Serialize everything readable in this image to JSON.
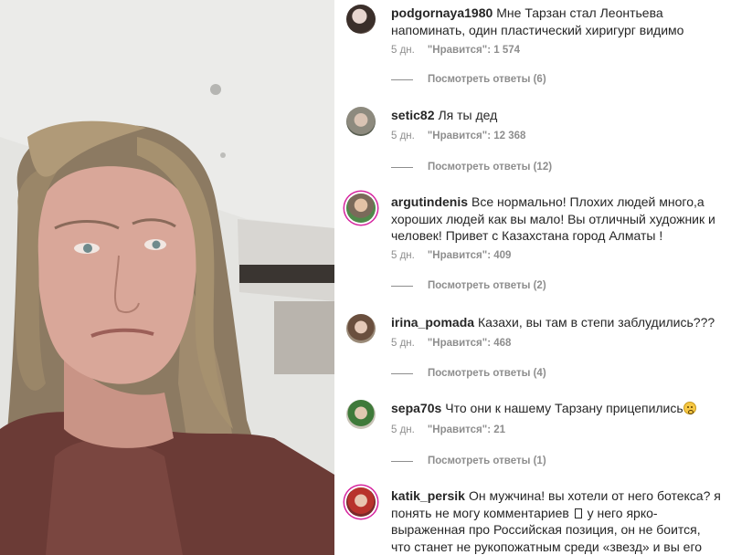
{
  "photo": {
    "description_icon": "portrait-photo"
  },
  "comments": [
    {
      "username": "podgornaya1980",
      "text": "Мне Тарзан стал Леонтьева напоминать, один пластический хиригург видимо",
      "time": "5 дн.",
      "likes": "\"Нравится\": 1 574",
      "replies": "Посмотреть ответы (6)"
    },
    {
      "username": "setic82",
      "text": "Ля ты дед",
      "time": "5 дн.",
      "likes": "\"Нравится\": 12 368",
      "replies": "Посмотреть ответы (12)"
    },
    {
      "username": "argutindenis",
      "text": "Все нормально! Плохих людей много,а хороших людей как вы мало! Вы отличный художник и человек! Привет с Казахстана город Алматы !",
      "time": "5 дн.",
      "likes": "\"Нравится\": 409",
      "replies": "Посмотреть ответы (2)"
    },
    {
      "username": "irina_pomada",
      "text": "Казахи, вы там в степи заблудились???",
      "time": "5 дн.",
      "likes": "\"Нравится\": 468",
      "replies": "Посмотреть ответы (4)"
    },
    {
      "username": "sepa70s",
      "text": "Что они к нашему Тарзану прицепились",
      "time": "5 дн.",
      "likes": "\"Нравится\": 21",
      "replies": "Посмотреть ответы (1)"
    },
    {
      "username": "katik_persik",
      "text_part1": "Он мужчина! вы хотели от него ботекса? я понять не могу комментариев",
      "text_part2": "у него ярко-выраженная про Российская позиция, он не боится, что станет не рукопожатным среди «звезд» и вы его хейтите, все норм у"
    }
  ],
  "colors": {
    "secondary_text": "#8e8e8e",
    "primary_text": "#262626",
    "story_ring": "#d6249f"
  }
}
